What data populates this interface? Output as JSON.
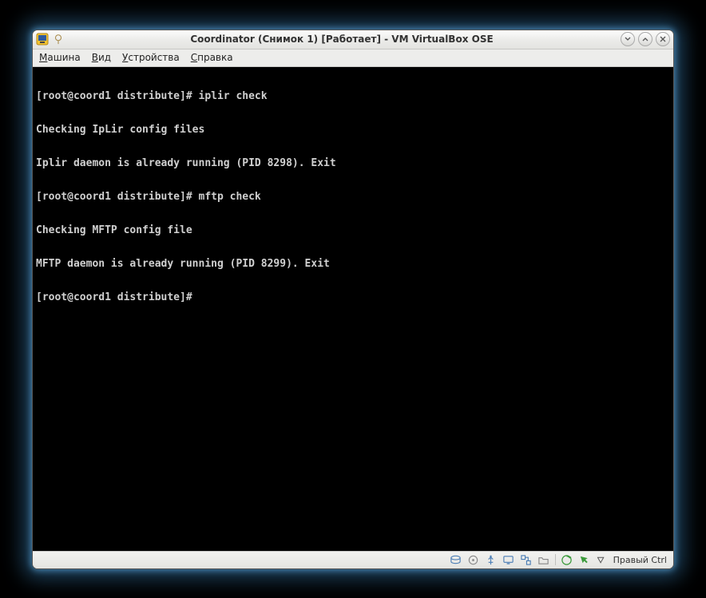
{
  "window": {
    "title": "Coordinator (Снимок 1) [Работает] - VM VirtualBox OSE"
  },
  "menubar": {
    "items": [
      {
        "label": "Машина",
        "accel_index": 0
      },
      {
        "label": "Вид",
        "accel_index": 0
      },
      {
        "label": "Устройства",
        "accel_index": 0
      },
      {
        "label": "Справка",
        "accel_index": 0
      }
    ]
  },
  "terminal": {
    "lines": [
      "[root@coord1 distribute]# iplir check",
      "Checking IpLir config files",
      "Iplir daemon is already running (PID 8298). Exit",
      "[root@coord1 distribute]# mftp check",
      "Checking MFTP config file",
      "MFTP daemon is already running (PID 8299). Exit",
      "[root@coord1 distribute]# "
    ]
  },
  "statusbar": {
    "hostkey_label": "Правый Ctrl",
    "icons": [
      "disk-icon",
      "server-icon",
      "usb-icon",
      "display-icon",
      "network-icon",
      "shared-folder-icon",
      "capture-icon",
      "mouse-integration-icon"
    ]
  }
}
